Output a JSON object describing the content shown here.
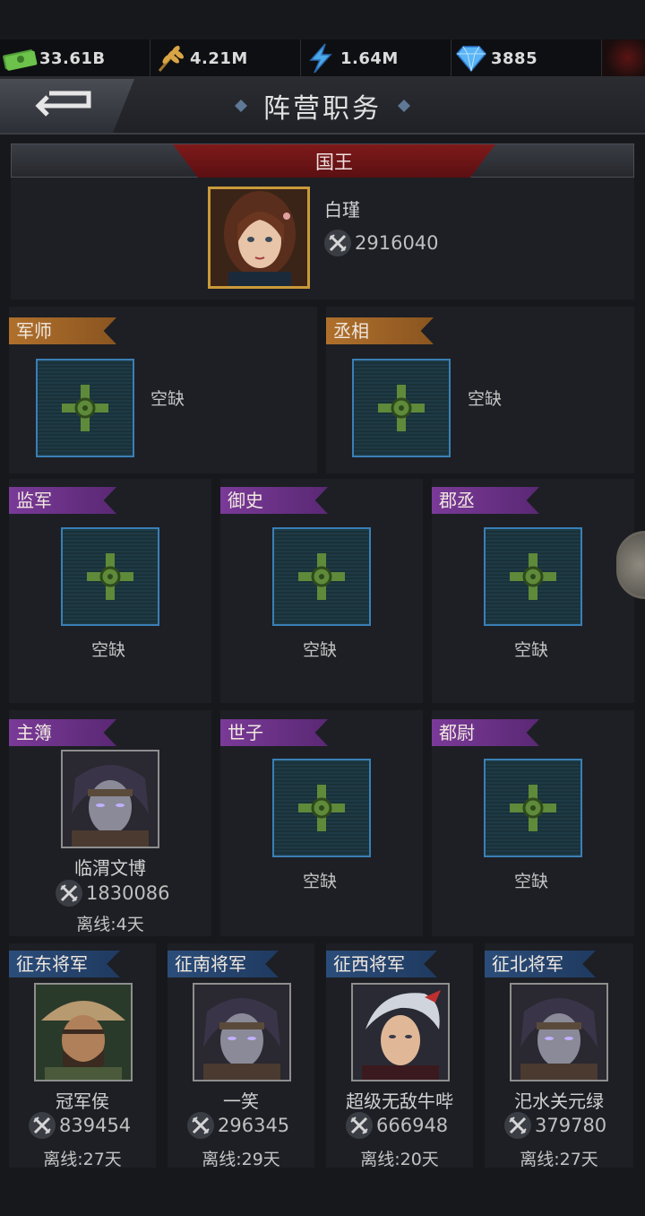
{
  "resources": [
    {
      "icon": "cash-icon",
      "value": "33.61B"
    },
    {
      "icon": "wheat-icon",
      "value": "4.21M"
    },
    {
      "icon": "lightning-icon",
      "value": "1.64M"
    },
    {
      "icon": "diamond-icon",
      "value": "3885"
    }
  ],
  "header": {
    "title": "阵营职务",
    "back_icon": "back-arrow-icon"
  },
  "king": {
    "title": "国王",
    "name": "白瑾",
    "power": "2916040"
  },
  "row1": [
    {
      "title": "军师",
      "status": "空缺"
    },
    {
      "title": "丞相",
      "status": "空缺"
    }
  ],
  "row2": [
    {
      "title": "监军",
      "status": "空缺"
    },
    {
      "title": "御史",
      "status": "空缺"
    },
    {
      "title": "郡丞",
      "status": "空缺"
    }
  ],
  "row3": [
    {
      "title": "主簿",
      "name": "临渭文博",
      "power": "1830086",
      "offline": "离线:4天"
    },
    {
      "title": "世子",
      "status": "空缺"
    },
    {
      "title": "都尉",
      "status": "空缺"
    }
  ],
  "generals": [
    {
      "title": "征东将军",
      "name": "冠军侯",
      "power": "839454",
      "offline": "离线:27天"
    },
    {
      "title": "征南将军",
      "name": "一笑",
      "power": "296345",
      "offline": "离线:29天"
    },
    {
      "title": "征西将军",
      "name": "超级无敌牛哔",
      "power": "666948",
      "offline": "离线:20天"
    },
    {
      "title": "征北将军",
      "name": "汜水关元绿",
      "power": "379780",
      "offline": "离线:27天"
    }
  ]
}
